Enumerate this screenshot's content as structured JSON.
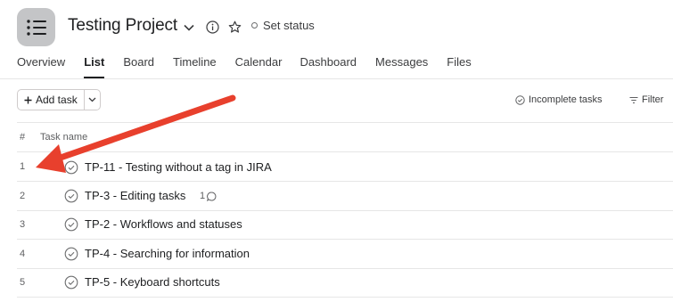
{
  "header": {
    "title": "Testing Project",
    "set_status_label": "Set status"
  },
  "tabs": [
    {
      "label": "Overview",
      "active": false
    },
    {
      "label": "List",
      "active": true
    },
    {
      "label": "Board",
      "active": false
    },
    {
      "label": "Timeline",
      "active": false
    },
    {
      "label": "Calendar",
      "active": false
    },
    {
      "label": "Dashboard",
      "active": false
    },
    {
      "label": "Messages",
      "active": false
    },
    {
      "label": "Files",
      "active": false
    }
  ],
  "toolbar": {
    "add_task_label": "Add task",
    "incomplete_label": "Incomplete tasks",
    "filter_label": "Filter"
  },
  "table": {
    "col_num": "#",
    "col_name": "Task name",
    "rows": [
      {
        "num": "1",
        "title": "TP-11 - Testing without a tag in JIRA"
      },
      {
        "num": "2",
        "title": "TP-3 - Editing tasks",
        "comments": "1"
      },
      {
        "num": "3",
        "title": "TP-2 - Workflows and statuses"
      },
      {
        "num": "4",
        "title": "TP-4 - Searching for information"
      },
      {
        "num": "5",
        "title": "TP-5 - Keyboard shortcuts"
      }
    ]
  },
  "colors": {
    "annotation_arrow": "#e8402d",
    "project_icon_bg": "#c4c5c7"
  }
}
